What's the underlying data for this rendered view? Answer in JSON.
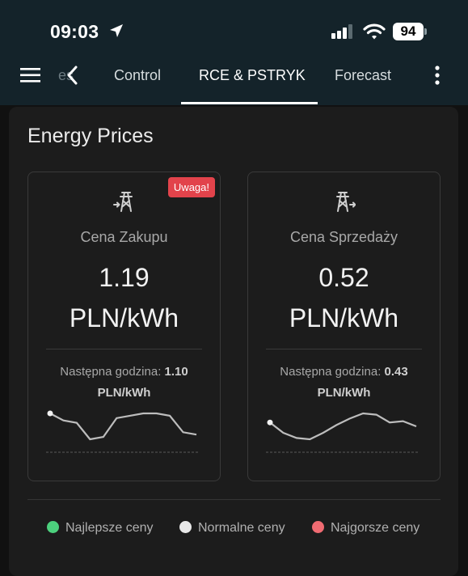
{
  "status_bar": {
    "time": "09:03",
    "battery": "94"
  },
  "tabs": {
    "partial_label": "es",
    "items": [
      {
        "label": "Control"
      },
      {
        "label": "RCE & PSTRYK",
        "active": true
      },
      {
        "label": "Forecast"
      }
    ]
  },
  "card": {
    "title": "Energy Prices",
    "buy": {
      "label": "Cena Zakupu",
      "value": "1.19",
      "unit": "PLN/kWh",
      "next_prefix": "Następna godzina:",
      "next_value": "1.10",
      "next_unit": "PLN/kWh",
      "badge": "Uwaga!",
      "trend": [
        1.19,
        1.16,
        1.15,
        1.08,
        1.09,
        1.17,
        1.18,
        1.19,
        1.19,
        1.18,
        1.11,
        1.1
      ]
    },
    "sell": {
      "label": "Cena Sprzedaży",
      "value": "0.52",
      "unit": "PLN/kWh",
      "next_prefix": "Następna godzina:",
      "next_value": "0.43",
      "next_unit": "PLN/kWh",
      "trend": [
        0.52,
        0.44,
        0.4,
        0.39,
        0.44,
        0.5,
        0.55,
        0.59,
        0.58,
        0.52,
        0.53,
        0.49
      ]
    }
  },
  "legend": [
    {
      "label": "Najlepsze ceny",
      "color": "#4cd07d"
    },
    {
      "label": "Normalne ceny",
      "color": "#e8e8e8"
    },
    {
      "label": "Najgorsze ceny",
      "color": "#f06b72"
    }
  ],
  "colors": {
    "header_bg": "#14232a",
    "card_bg": "#1c1c1c",
    "badge": "#e2434b",
    "spark_line": "#bdbdbd"
  }
}
